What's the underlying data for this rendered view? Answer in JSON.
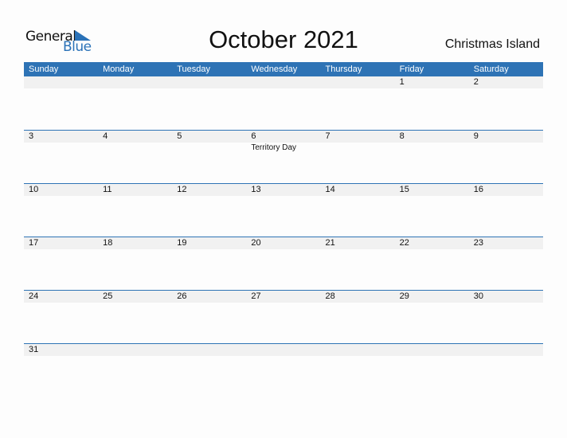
{
  "logo": {
    "general": "General",
    "blue": "Blue",
    "brand_color": "#2a72b8"
  },
  "title": "October 2021",
  "country": "Christmas Island",
  "header_color": "#2e73b5",
  "weekdays": [
    "Sunday",
    "Monday",
    "Tuesday",
    "Wednesday",
    "Thursday",
    "Friday",
    "Saturday"
  ],
  "weeks": [
    {
      "days": [
        "",
        "",
        "",
        "",
        "",
        "1",
        "2"
      ],
      "events": [
        "",
        "",
        "",
        "",
        "",
        "",
        ""
      ]
    },
    {
      "days": [
        "3",
        "4",
        "5",
        "6",
        "7",
        "8",
        "9"
      ],
      "events": [
        "",
        "",
        "",
        "Territory Day",
        "",
        "",
        ""
      ]
    },
    {
      "days": [
        "10",
        "11",
        "12",
        "13",
        "14",
        "15",
        "16"
      ],
      "events": [
        "",
        "",
        "",
        "",
        "",
        "",
        ""
      ]
    },
    {
      "days": [
        "17",
        "18",
        "19",
        "20",
        "21",
        "22",
        "23"
      ],
      "events": [
        "",
        "",
        "",
        "",
        "",
        "",
        ""
      ]
    },
    {
      "days": [
        "24",
        "25",
        "26",
        "27",
        "28",
        "29",
        "30"
      ],
      "events": [
        "",
        "",
        "",
        "",
        "",
        "",
        ""
      ]
    },
    {
      "days": [
        "31",
        "",
        "",
        "",
        "",
        "",
        ""
      ],
      "events": [
        "",
        "",
        "",
        "",
        "",
        "",
        ""
      ]
    }
  ]
}
